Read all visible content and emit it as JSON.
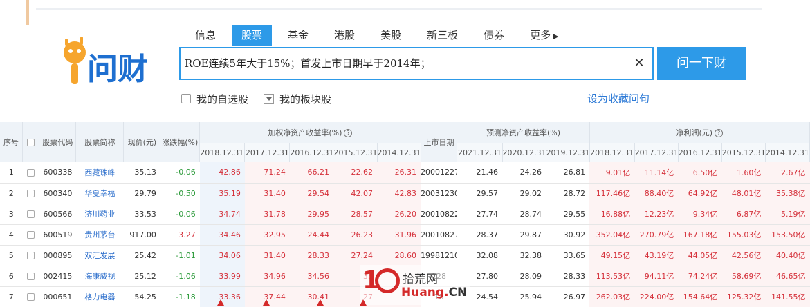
{
  "nav": {
    "items": [
      "信息",
      "股票",
      "基金",
      "港股",
      "美股",
      "新三板",
      "债券",
      "更多"
    ],
    "active_index": 1,
    "more_arrow": "▶"
  },
  "logo": {
    "text": "问财",
    "icon": "mascot-icon"
  },
  "search": {
    "query": "ROE连续5年大于15%；首发上市日期早于2014年；",
    "clear_icon": "close-icon",
    "button_label": "问一下财"
  },
  "options": {
    "my_stocks": "我的自选股",
    "my_sectors": "我的板块股",
    "save_query": "设为收藏问句"
  },
  "table": {
    "headers_top": {
      "index": "序号",
      "code": "股票代码",
      "name": "股票简称",
      "price": "现价(元)",
      "change": "涨跌幅(%)",
      "roe": "加权净资产收益率(%)",
      "ipo_date": "上市日期",
      "forecast_roe": "预测净资产收益率(%)",
      "net_profit": "净利润(元)"
    },
    "roe_years": [
      "2018.12.31",
      "2017.12.31",
      "2016.12.31",
      "2015.12.31",
      "2014.12.31"
    ],
    "forecast_years": [
      "2021.12.31",
      "2020.12.31",
      "2019.12.31"
    ],
    "profit_years": [
      "2018.12.31",
      "2017.12.31",
      "2016.12.31",
      "2015.12.31",
      "2014.12.31"
    ],
    "sort_indicator": "↓",
    "unit_yi": "亿",
    "rows": [
      {
        "idx": "1",
        "code": "600338",
        "name": "西藏珠峰",
        "price": "35.13",
        "change": "-0.06",
        "roe": [
          "42.86",
          "71.24",
          "66.21",
          "22.62",
          "26.31"
        ],
        "ipo": "20001227",
        "forecast": [
          "21.46",
          "24.26",
          "26.81"
        ],
        "profit": [
          "9.01",
          "11.14",
          "6.50",
          "1.60",
          "2.67"
        ]
      },
      {
        "idx": "2",
        "code": "600340",
        "name": "华夏幸福",
        "price": "29.79",
        "change": "-0.50",
        "roe": [
          "35.19",
          "31.40",
          "29.54",
          "42.07",
          "42.83"
        ],
        "ipo": "20031230",
        "forecast": [
          "29.57",
          "29.02",
          "28.72"
        ],
        "profit": [
          "117.46",
          "88.40",
          "64.92",
          "48.01",
          "35.38"
        ]
      },
      {
        "idx": "3",
        "code": "600566",
        "name": "济川药业",
        "price": "33.53",
        "change": "-0.06",
        "roe": [
          "34.74",
          "31.78",
          "29.95",
          "28.57",
          "26.20"
        ],
        "ipo": "20010822",
        "forecast": [
          "27.74",
          "28.74",
          "29.55"
        ],
        "profit": [
          "16.88",
          "12.23",
          "9.34",
          "6.87",
          "5.19"
        ]
      },
      {
        "idx": "4",
        "code": "600519",
        "name": "贵州茅台",
        "price": "917.00",
        "change": "3.27",
        "roe": [
          "34.46",
          "32.95",
          "24.44",
          "26.23",
          "31.96"
        ],
        "ipo": "20010827",
        "forecast": [
          "28.37",
          "29.87",
          "30.92"
        ],
        "profit": [
          "352.04",
          "270.79",
          "167.18",
          "155.03",
          "153.50"
        ]
      },
      {
        "idx": "5",
        "code": "000895",
        "name": "双汇发展",
        "price": "25.42",
        "change": "-1.01",
        "roe": [
          "34.06",
          "31.40",
          "28.33",
          "27.24",
          "28.60"
        ],
        "ipo": "19981210",
        "forecast": [
          "32.08",
          "32.38",
          "33.65"
        ],
        "profit": [
          "49.15",
          "43.19",
          "44.05",
          "42.56",
          "40.40"
        ]
      },
      {
        "idx": "6",
        "code": "002415",
        "name": "海康威视",
        "price": "25.12",
        "change": "-1.06",
        "roe": [
          "33.99",
          "34.96",
          "34.56",
          "35",
          ""
        ],
        "ipo": "128",
        "forecast": [
          "27.80",
          "28.09",
          "28.33"
        ],
        "profit": [
          "113.53",
          "94.11",
          "74.24",
          "58.69",
          "46.65"
        ]
      },
      {
        "idx": "7",
        "code": "000651",
        "name": "格力电器",
        "price": "54.25",
        "change": "-1.18",
        "roe": [
          "33.36",
          "37.44",
          "30.41",
          "27",
          ""
        ],
        "ipo": "18",
        "forecast": [
          "24.54",
          "25.94",
          "26.97"
        ],
        "profit": [
          "262.03",
          "224.00",
          "154.64",
          "125.32",
          "141.55"
        ]
      }
    ]
  },
  "watermark": {
    "top": "拾荒网",
    "bottom_left": "Huang.",
    "bottom_right": "CN"
  },
  "colors": {
    "accent": "#2d9ae8",
    "negative": "#2c9a3a",
    "positive": "#d5313b",
    "link": "#2d6fcc"
  }
}
